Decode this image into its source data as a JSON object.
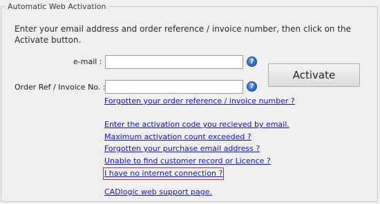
{
  "group": {
    "title": "Automatic Web Activation"
  },
  "instructions": "Enter your email address and order reference / invoice number, then click on the Activate button.",
  "form": {
    "email_label": "e-mail :",
    "email_value": "",
    "order_label": "Order Ref / Invoice No. :",
    "order_value": "",
    "help_glyph": "?"
  },
  "activate_label": "Activate",
  "links": {
    "forgotten_order_ref": "Forgotten your order reference / invoice number ?",
    "enter_activation_code": "Enter the activation code you recieved by email.",
    "max_activation_count": "Maximum activation count exceeded ?",
    "forgotten_email": "Forgotten your purchase email address ?",
    "unable_find_record": "Unable to find customer record or Licence ?",
    "no_internet": "I have no internet connection ?",
    "web_support": "CADlogic web support page."
  },
  "colors": {
    "link": "#1010e0",
    "highlight_border": "#cc2a2a",
    "help_icon": "#2f6fcb"
  }
}
